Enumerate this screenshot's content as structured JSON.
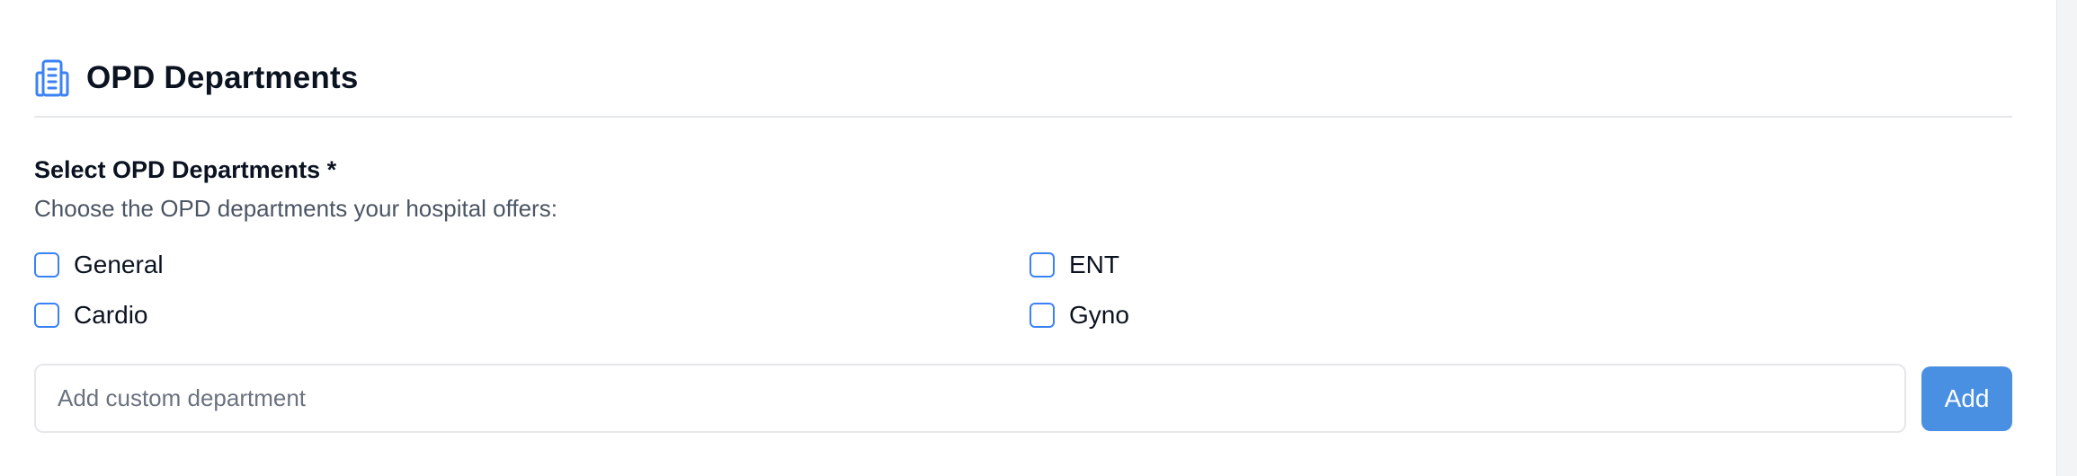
{
  "section": {
    "title": "OPD Departments",
    "icon": "hospital-building-icon",
    "accent_color": "#4a90e2"
  },
  "field": {
    "label": "Select OPD Departments *",
    "help": "Choose the OPD departments your hospital offers:"
  },
  "departments": [
    {
      "label": "General",
      "checked": false
    },
    {
      "label": "ENT",
      "checked": false
    },
    {
      "label": "Cardio",
      "checked": false
    },
    {
      "label": "Gyno",
      "checked": false
    }
  ],
  "custom": {
    "placeholder": "Add custom department",
    "value": "",
    "add_label": "Add"
  }
}
